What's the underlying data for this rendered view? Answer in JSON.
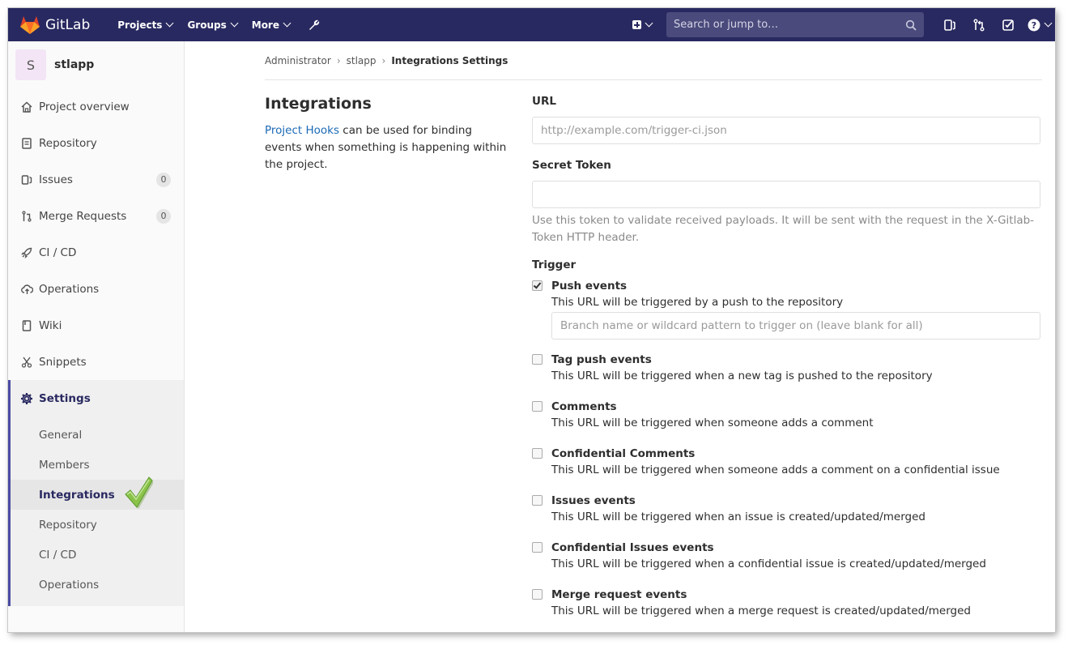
{
  "navbar": {
    "brand": "GitLab",
    "menu": [
      "Projects",
      "Groups",
      "More"
    ],
    "search_placeholder": "Search or jump to…"
  },
  "sidebar": {
    "project_initial": "S",
    "project_name": "stlapp",
    "items": [
      {
        "label": "Project overview",
        "icon": "home-icon"
      },
      {
        "label": "Repository",
        "icon": "doc-icon"
      },
      {
        "label": "Issues",
        "icon": "issues-icon",
        "badge": "0"
      },
      {
        "label": "Merge Requests",
        "icon": "merge-request-icon",
        "badge": "0"
      },
      {
        "label": "CI / CD",
        "icon": "rocket-icon"
      },
      {
        "label": "Operations",
        "icon": "cloud-icon"
      },
      {
        "label": "Wiki",
        "icon": "book-icon"
      },
      {
        "label": "Snippets",
        "icon": "scissors-icon"
      }
    ],
    "settings_label": "Settings",
    "settings_sub": [
      "General",
      "Members",
      "Integrations",
      "Repository",
      "CI / CD",
      "Operations"
    ]
  },
  "breadcrumb": [
    "Administrator",
    "stlapp",
    "Integrations Settings"
  ],
  "intro": {
    "title": "Integrations",
    "link": "Project Hooks",
    "text": " can be used for binding events when something is happening within the project."
  },
  "form": {
    "url_label": "URL",
    "url_placeholder": "http://example.com/trigger-ci.json",
    "token_label": "Secret Token",
    "token_value": "",
    "token_help": "Use this token to validate received payloads. It will be sent with the request in the X-Gitlab-Token HTTP header.",
    "trigger_label": "Trigger",
    "branch_placeholder": "Branch name or wildcard pattern to trigger on (leave blank for all)",
    "triggers": [
      {
        "title": "Push events",
        "desc": "This URL will be triggered by a push to the repository",
        "checked": true
      },
      {
        "title": "Tag push events",
        "desc": "This URL will be triggered when a new tag is pushed to the repository",
        "checked": false
      },
      {
        "title": "Comments",
        "desc": "This URL will be triggered when someone adds a comment",
        "checked": false
      },
      {
        "title": "Confidential Comments",
        "desc": "This URL will be triggered when someone adds a comment on a confidential issue",
        "checked": false
      },
      {
        "title": "Issues events",
        "desc": "This URL will be triggered when an issue is created/updated/merged",
        "checked": false
      },
      {
        "title": "Confidential Issues events",
        "desc": "This URL will be triggered when a confidential issue is created/updated/merged",
        "checked": false
      },
      {
        "title": "Merge request events",
        "desc": "This URL will be triggered when a merge request is created/updated/merged",
        "checked": false
      }
    ]
  },
  "colors": {
    "navbar": "#292961",
    "link": "#1b69b6",
    "accent": "#4b4ba3"
  }
}
